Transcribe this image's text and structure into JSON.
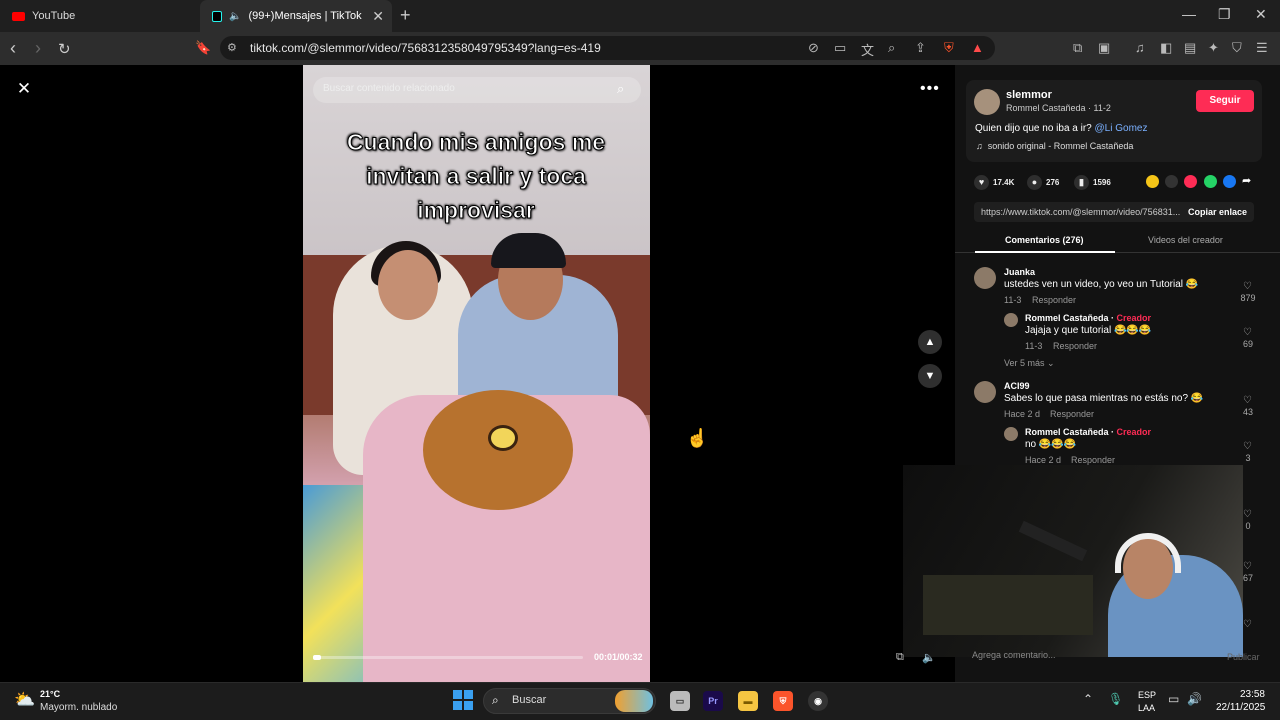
{
  "browser": {
    "tabs": [
      {
        "label": "YouTube",
        "icon": "youtube-icon"
      },
      {
        "label": "(99+)Mensajes | TikTok",
        "icon": "tiktok-icon",
        "active": true
      }
    ],
    "url": "tiktok.com/@slemmor/video/7568312358049795349?lang=es-419"
  },
  "video": {
    "search_placeholder": "Buscar contenido relacionado",
    "caption_lines": [
      "Cuando mis amigos me",
      "invitan a salir y toca",
      "improvisar"
    ],
    "timecode": "00:01/00:32",
    "progress": 0.03
  },
  "author": {
    "username": "slemmor",
    "subline": "Rommel Castañeda · 11-2",
    "follow_label": "Seguir",
    "description": "Quien dijo que no iba a ir?",
    "mention": "@Li Gomez",
    "sound": "sonido original - Rommel Castañeda"
  },
  "stats": {
    "likes": "17.4K",
    "comments": "276",
    "saves": "1596"
  },
  "share": {
    "link": "https://www.tiktok.com/@slemmor/video/756831...",
    "copy_label": "Copiar enlace"
  },
  "panel_tabs": {
    "comments": "Comentarios (276)",
    "videos": "Videos del creador"
  },
  "comments": [
    {
      "name": "Juanka",
      "text": "ustedes ven un video, yo veo un Tutorial 😂",
      "date": "11-3",
      "reply": "Responder",
      "likes": "879"
    },
    {
      "name": "Rommel Castañeda",
      "creator": "Creador",
      "text": "Jajaja y que tutorial 😂😂😂",
      "date": "11-3",
      "reply": "Responder",
      "likes": "69"
    },
    {
      "name": "ACI99",
      "text": "Sabes lo que pasa mientras no estás no? 😂",
      "date": "Hace 2 d",
      "reply": "Responder",
      "likes": "43"
    },
    {
      "name": "Rommel Castañeda",
      "creator": "Creador",
      "text": "no 😂😂😂",
      "date": "Hace 2 d",
      "reply": "Responder",
      "likes": "3"
    }
  ],
  "more_replies": "Ver 5 más",
  "hidden_counts": [
    "0",
    "67"
  ],
  "comment_input": "Agrega comentario...",
  "publish_label": "Publicar",
  "taskbar": {
    "temperature": "21°C",
    "condition": "Mayorm. nublado",
    "search_label": "Buscar",
    "lang1": "ESP",
    "lang2": "LAA",
    "time": "23:58",
    "date": "22/11/2025"
  },
  "colors": {
    "accent": "#fe2c55",
    "mention": "#7ab0ff"
  }
}
